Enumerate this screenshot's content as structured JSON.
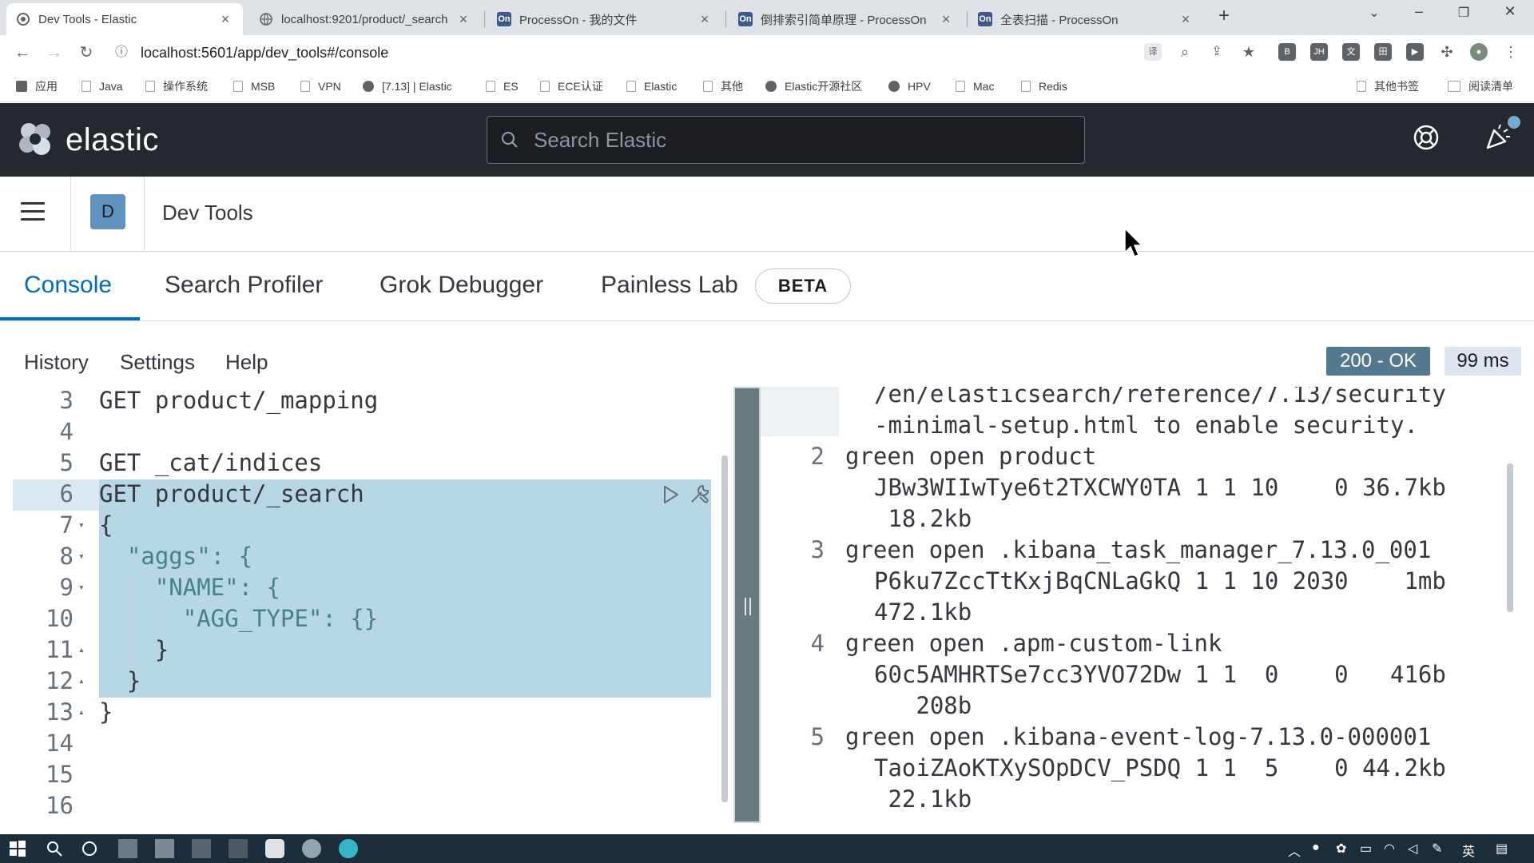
{
  "browser": {
    "tabs": [
      {
        "title": "Dev Tools - Elastic",
        "favicon": "elastic"
      },
      {
        "title": "localhost:9201/product/_search",
        "favicon": "globe"
      },
      {
        "title": "ProcessOn - 我的文件",
        "favicon": "On"
      },
      {
        "title": "倒排索引简单原理 - ProcessOn",
        "favicon": "On"
      },
      {
        "title": "全表扫描 - ProcessOn",
        "favicon": "On"
      }
    ],
    "url": "localhost:5601/app/dev_tools#/console",
    "bookmarks": [
      {
        "label": "应用",
        "icon": "apps-icon"
      },
      {
        "label": "Java",
        "icon": "bookmark-icon"
      },
      {
        "label": "操作系统",
        "icon": "bookmark-icon"
      },
      {
        "label": "MSB",
        "icon": "bookmark-icon"
      },
      {
        "label": "VPN",
        "icon": "bookmark-icon"
      },
      {
        "label": "[7.13] | Elastic",
        "icon": "elastic-icon"
      },
      {
        "label": "ES",
        "icon": "bookmark-icon"
      },
      {
        "label": "ECE认证",
        "icon": "bookmark-icon"
      },
      {
        "label": "Elastic",
        "icon": "bookmark-icon"
      },
      {
        "label": "其他",
        "icon": "bookmark-icon"
      },
      {
        "label": "Elastic开源社区",
        "icon": "globe-icon"
      },
      {
        "label": "HPV",
        "icon": "globe-icon"
      },
      {
        "label": "Mac",
        "icon": "bookmark-icon"
      },
      {
        "label": "Redis",
        "icon": "bookmark-icon"
      }
    ],
    "other_bookmarks": "其他书签",
    "reading_list": "阅读清单"
  },
  "kibana": {
    "brand": "elastic",
    "search_placeholder": "Search Elastic",
    "space_initial": "D",
    "breadcrumb": "Dev Tools",
    "tabs": [
      "Console",
      "Search Profiler",
      "Grok Debugger",
      "Painless Lab"
    ],
    "beta_badge": "BETA",
    "submenu": [
      "History",
      "Settings",
      "Help"
    ],
    "status": "200 - OK",
    "duration": "99 ms"
  },
  "editor": {
    "lines": [
      {
        "n": "3",
        "text": "GET product/_mapping"
      },
      {
        "n": "4",
        "text": ""
      },
      {
        "n": "5",
        "text": "GET _cat/indices"
      },
      {
        "n": "6",
        "text": "GET product/_search"
      },
      {
        "n": "7",
        "text": "{"
      },
      {
        "n": "8",
        "text": "  \"aggs\": {"
      },
      {
        "n": "9",
        "text": "    \"NAME\": {"
      },
      {
        "n": "10",
        "text": "      \"AGG_TYPE\": {}"
      },
      {
        "n": "11",
        "text": "    }"
      },
      {
        "n": "12",
        "text": "  }"
      },
      {
        "n": "13",
        "text": "}"
      },
      {
        "n": "14",
        "text": ""
      },
      {
        "n": "15",
        "text": ""
      },
      {
        "n": "16",
        "text": ""
      }
    ]
  },
  "output": {
    "lines": [
      {
        "n": "",
        "text": "/en/elasticsearch/reference/7.13/security"
      },
      {
        "n": "",
        "text": "-minimal-setup.html to enable security."
      },
      {
        "n": "2",
        "text": "green open product"
      },
      {
        "n": "",
        "text": "JBw3WIIwTye6t2TXCWY0TA 1 1 10    0 36.7kb"
      },
      {
        "n": "",
        "text": " 18.2kb"
      },
      {
        "n": "3",
        "text": "green open .kibana_task_manager_7.13.0_001"
      },
      {
        "n": "",
        "text": "P6ku7ZccTtKxjBqCNLaGkQ 1 1 10 2030    1mb"
      },
      {
        "n": "",
        "text": "472.1kb"
      },
      {
        "n": "4",
        "text": "green open .apm-custom-link"
      },
      {
        "n": "",
        "text": "60c5AMHRTSe7cc3YVO72Dw 1 1  0    0   416b"
      },
      {
        "n": "",
        "text": "   208b"
      },
      {
        "n": "5",
        "text": "green open .kibana-event-log-7.13.0-000001"
      },
      {
        "n": "",
        "text": "TaoiZAoKTXySOpDCV_PSDQ 1 1  5    0 44.2kb"
      },
      {
        "n": "",
        "text": " 22.1kb"
      }
    ]
  },
  "taskbar": {
    "ime": "英"
  },
  "colors": {
    "header_bg": "#25282f",
    "accent": "#006bb8",
    "status_ok": "#54798f",
    "selection": "#b8d7e6"
  }
}
